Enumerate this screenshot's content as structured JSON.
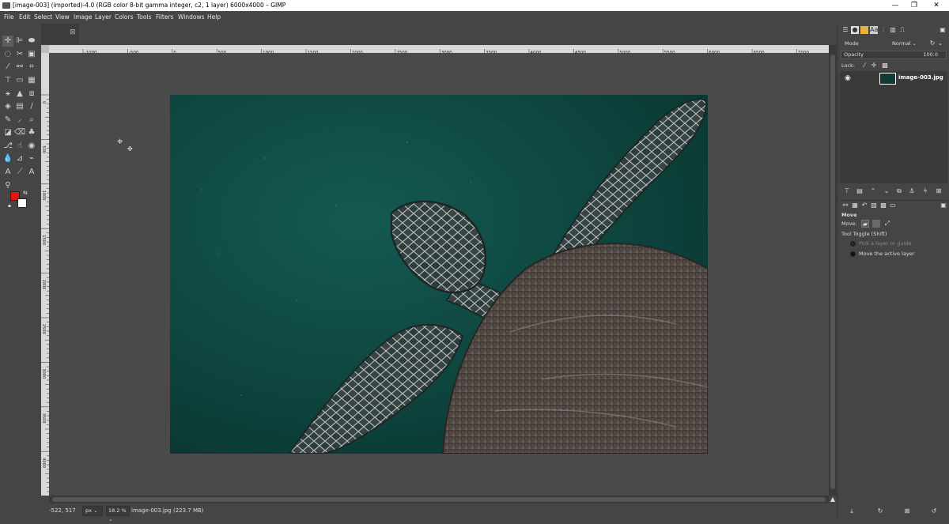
{
  "window": {
    "title": "[image-003] (imported)-4.0 (RGB color 8-bit gamma integer, c2, 1 layer) 6000x4000 – GIMP",
    "minimize": "—",
    "maximize": "❐",
    "close": "✕"
  },
  "menu": [
    "File",
    "Edit",
    "Select",
    "View",
    "Image",
    "Layer",
    "Colors",
    "Tools",
    "Filters",
    "Windows",
    "Help"
  ],
  "toolbox": {
    "tools": [
      "move-tool",
      "align-tool",
      "free-select-tool",
      "scissors-tool",
      "crop-tool",
      "transform-tool",
      "warp-transform-tool",
      "flip-tool",
      "paintbrush-tool",
      "text-tool",
      "zoom-tool"
    ],
    "foreground_color": "#ee1111",
    "background_color": "#ffffff"
  },
  "ruler": {
    "h_labels": [
      "-1000",
      "-500",
      "0",
      "500",
      "1000",
      "1500",
      "2000",
      "2500",
      "3000",
      "3500",
      "4000",
      "4500",
      "5000",
      "5500",
      "6000",
      "6500",
      "7000"
    ],
    "v_labels": [
      "0",
      "500",
      "1000",
      "1500",
      "2000",
      "2500",
      "3000",
      "3500",
      "4000",
      "4500"
    ]
  },
  "statusbar": {
    "coords": "-522, 517",
    "unit": "px",
    "zoom": "18.2 %",
    "file_info": "image-003.jpg (223.7 MB)"
  },
  "layers_panel": {
    "mode_label": "Mode",
    "mode_value": "Normal",
    "opacity_label": "Opacity",
    "opacity_value": "100.0",
    "lock_label": "Lock:",
    "layers": [
      {
        "name": "image-003.jpg",
        "visible": true
      }
    ]
  },
  "tool_options": {
    "title": "Move",
    "move_label": "Move:",
    "toggle_label": "Tool Toggle  (Shift)",
    "option_pick": "Pick a layer or guide",
    "option_move": "Move the active layer"
  }
}
